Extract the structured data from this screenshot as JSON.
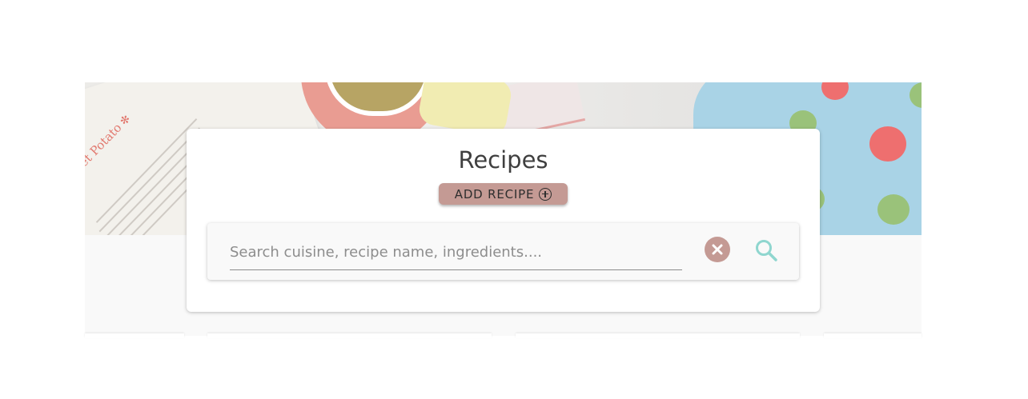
{
  "panel": {
    "title": "Recipes",
    "add_button_label": "ADD RECIPE"
  },
  "search": {
    "placeholder": "Search cuisine, recipe name, ingredients....",
    "value": ""
  },
  "hero": {
    "book_title": "et Potato"
  },
  "icons": {
    "add": "plus-circle-icon",
    "clear": "close-circle-icon",
    "search": "search-icon"
  },
  "colors": {
    "accent": "#c49a94",
    "search_icon": "#8fd6cf",
    "title_text": "#3f3f3f"
  }
}
